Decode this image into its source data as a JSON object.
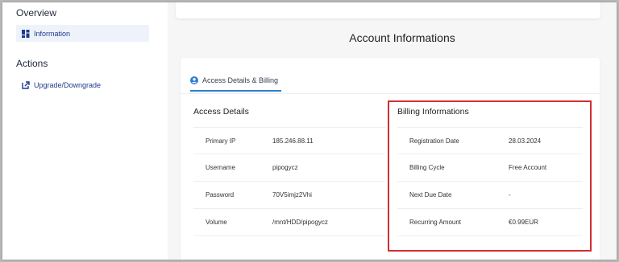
{
  "sidebar": {
    "overview_heading": "Overview",
    "items": [
      {
        "label": "Information",
        "icon": "dashboard-grid-icon",
        "active": true
      }
    ],
    "actions_heading": "Actions",
    "actions": [
      {
        "label": "Upgrade/Downgrade",
        "icon": "external-link-icon"
      }
    ]
  },
  "main": {
    "title": "Account Informations",
    "tab": {
      "label": "Access Details & Billing",
      "icon": "account-circle-icon"
    },
    "access": {
      "title": "Access Details",
      "rows": [
        {
          "label": "Primary IP",
          "value": "185.246.88.11"
        },
        {
          "label": "Username",
          "value": "pipogycz"
        },
        {
          "label": "Password",
          "value": "70V5imjz2Vhi"
        },
        {
          "label": "Volume",
          "value": "/mnt/HDD/pipogycz"
        }
      ]
    },
    "billing": {
      "title": "Billing Informations",
      "rows": [
        {
          "label": "Registration Date",
          "value": "28.03.2024"
        },
        {
          "label": "Billing Cycle",
          "value": "Free Account"
        },
        {
          "label": "Next Due Date",
          "value": "-"
        },
        {
          "label": "Recurring Amount",
          "value": "€0.99EUR"
        }
      ]
    }
  },
  "colors": {
    "accent": "#2f7fd3",
    "sidebar_text": "#1e3a8a",
    "highlight": "#d32f2f"
  }
}
